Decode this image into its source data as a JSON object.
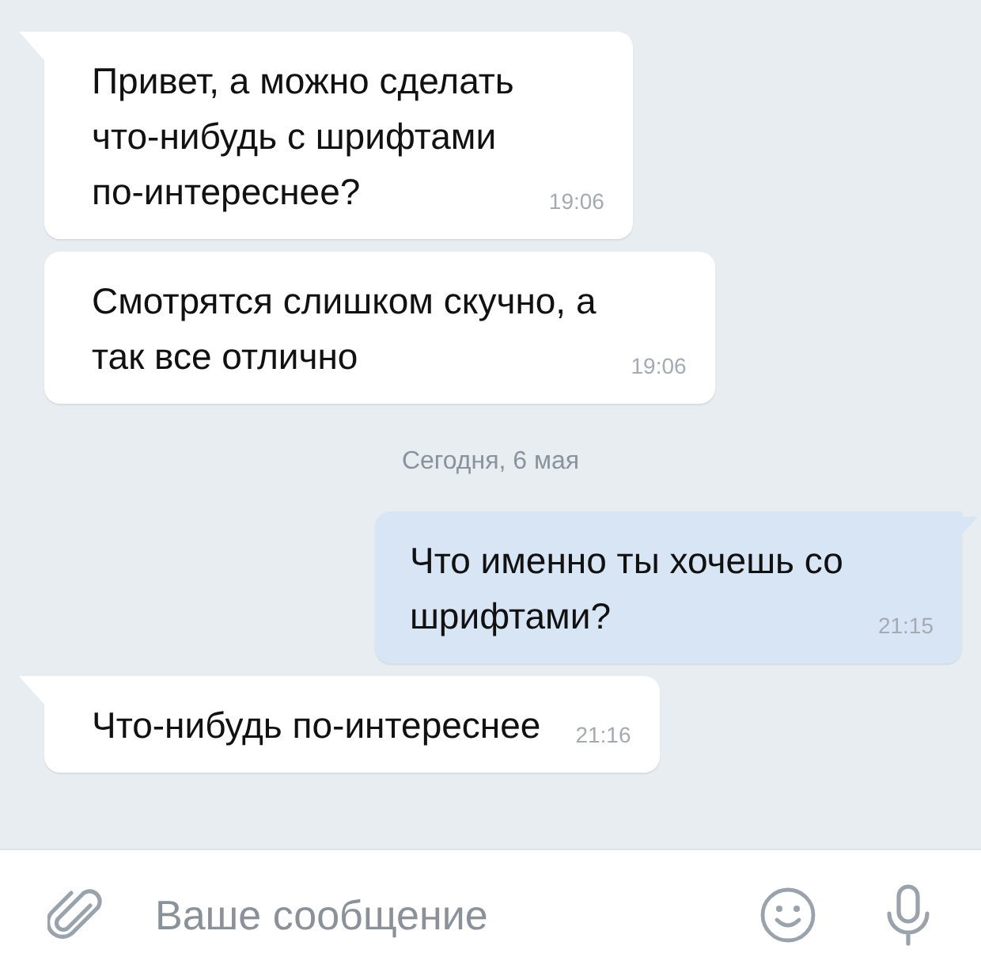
{
  "messages": [
    {
      "kind": "message",
      "outgoing": false,
      "tail": true,
      "text": "Привет, а можно сделать\nчто-нибудь с шрифтами\nпо-интереснее?",
      "time": "19:06"
    },
    {
      "kind": "message",
      "outgoing": false,
      "tail": false,
      "text": "Смотрятся слишком скучно, а\nтак все отлично",
      "time": "19:06"
    },
    {
      "kind": "date",
      "text": "Сегодня, 6 мая"
    },
    {
      "kind": "message",
      "outgoing": true,
      "tail": true,
      "text": "Что именно ты хочешь со\nшрифтами?",
      "time": "21:15"
    },
    {
      "kind": "message",
      "outgoing": false,
      "tail": true,
      "text": "Что-нибудь по-интереснее",
      "time": "21:16"
    }
  ],
  "composer": {
    "placeholder": "Ваше сообщение"
  }
}
